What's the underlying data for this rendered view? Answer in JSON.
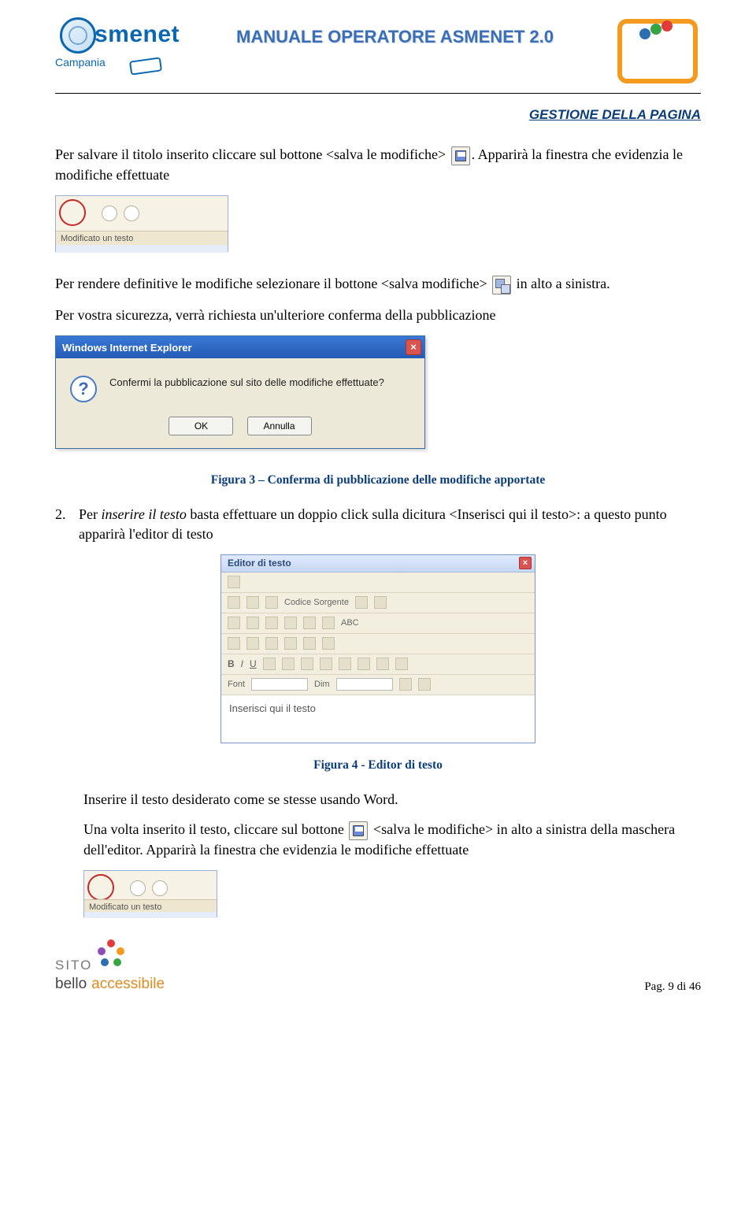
{
  "header": {
    "logo_left_text": "smenet",
    "logo_left_sub": "Campania",
    "title": "MANUALE OPERATORE ASMENET 2.0"
  },
  "section_link": "GESTIONE DELLA PAGINA",
  "p1_a": "Per salvare il titolo inserito cliccare sul bottone <salva le modifiche> ",
  "p1_b": ". Apparirà la finestra che evidenzia le modifiche effettuate",
  "toolbar_caption": "Modificato un testo",
  "p2_a": "Per rendere definitive le modifiche selezionare il bottone <salva modifiche> ",
  "p2_b": " in alto a sinistra.",
  "p3": "Per vostra sicurezza, verrà richiesta un'ulteriore conferma della pubblicazione",
  "dialog": {
    "title": "Windows Internet Explorer",
    "message": "Confermi la pubblicazione sul sito delle modifiche effettuate?",
    "ok": "OK",
    "cancel": "Annulla"
  },
  "caption_fig3": "Figura 3 – Conferma di pubblicazione delle modifiche apportate",
  "li2_num": "2.",
  "li2_a": "Per ",
  "li2_em": "inserire il testo",
  "li2_b": " basta effettuare un doppio click sulla dicitura <Inserisci qui il testo>: a questo punto apparirà l'editor di testo",
  "editor": {
    "title": "Editor di testo",
    "src": "Codice Sorgente",
    "font_lbl": "Font",
    "dim_lbl": "Dim",
    "placeholder": "Inserisci qui il testo"
  },
  "caption_fig4": "Figura 4 - Editor di testo",
  "p4": "Inserire il testo desiderato come se stesse usando Word.",
  "p5_a": "Una volta inserito il testo, cliccare sul bottone ",
  "p5_b": " <salva le modifiche> in alto a sinistra della maschera dell'editor. Apparirà la finestra che evidenzia le modifiche effettuate",
  "footer": {
    "sito": "SITO",
    "bello": "bello",
    "acc": "accessibile",
    "page": "Pag. 9 di 46"
  }
}
